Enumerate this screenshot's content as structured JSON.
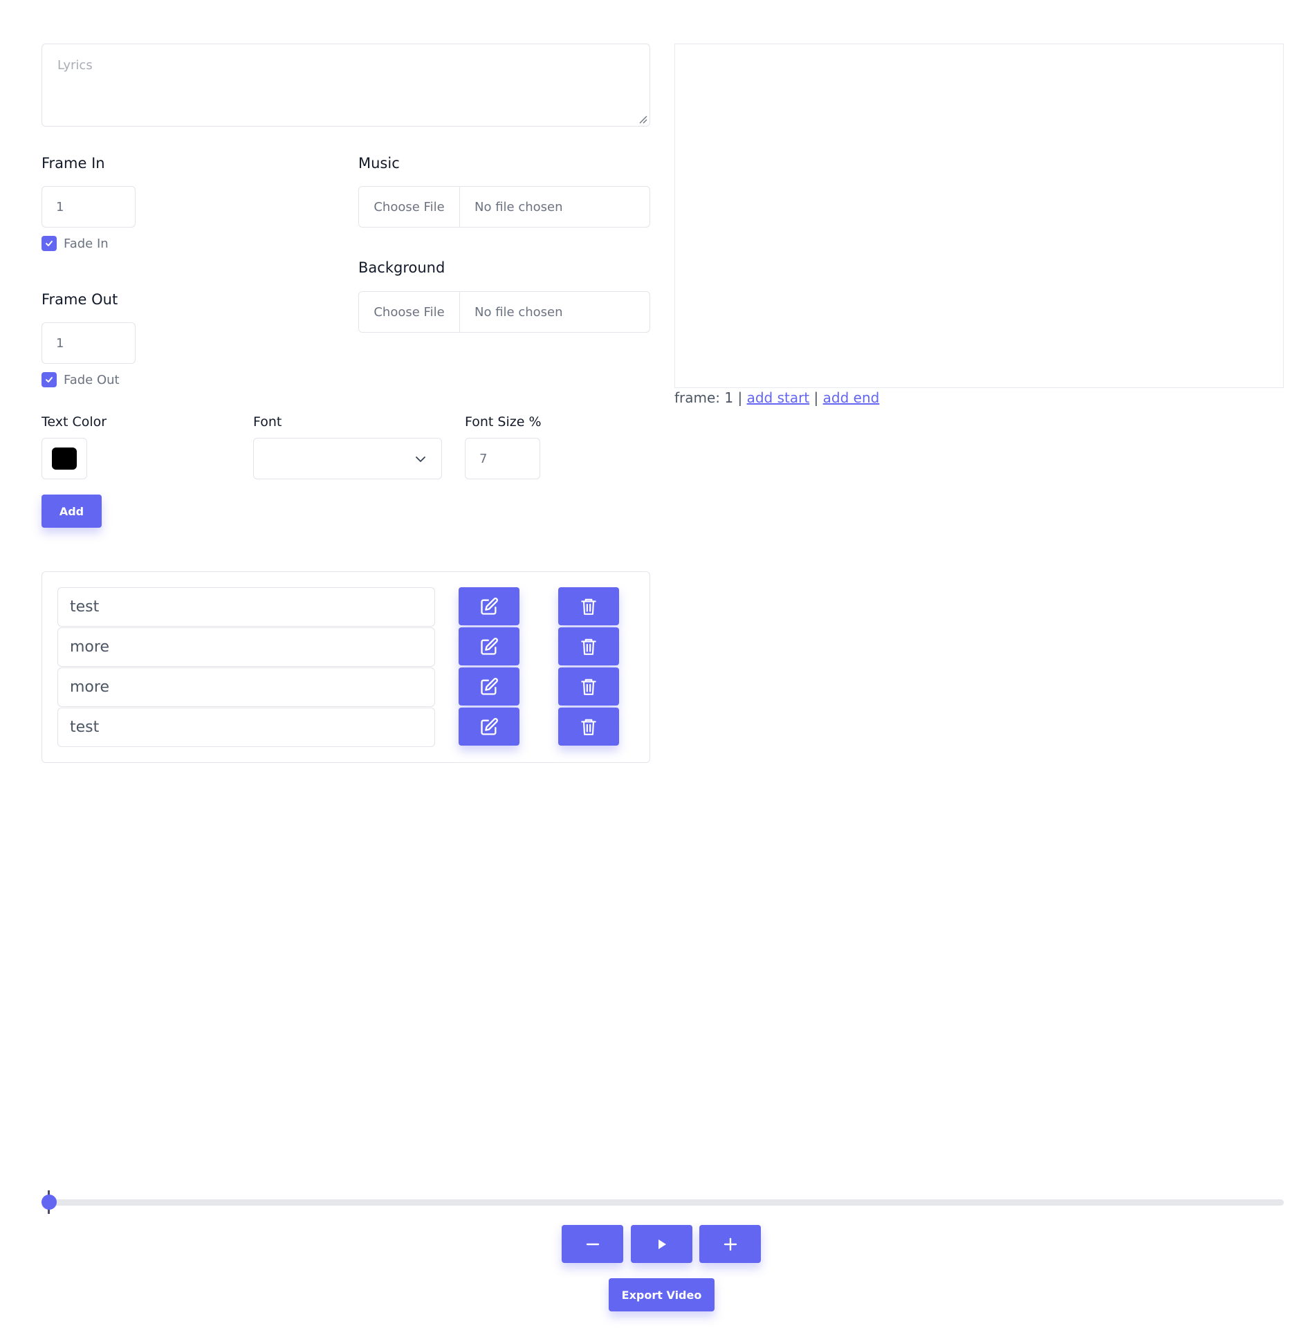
{
  "lyrics": {
    "placeholder": "Lyrics",
    "value": ""
  },
  "frame_in": {
    "label": "Frame In",
    "value": "1",
    "fade_label": "Fade In",
    "fade_checked": true
  },
  "frame_out": {
    "label": "Frame Out",
    "value": "1",
    "fade_label": "Fade Out",
    "fade_checked": true
  },
  "music": {
    "label": "Music",
    "button": "Choose File",
    "file": "No file chosen"
  },
  "background": {
    "label": "Background",
    "button": "Choose File",
    "file": "No file chosen"
  },
  "text_color": {
    "label": "Text Color",
    "value": "#000000"
  },
  "font": {
    "label": "Font",
    "value": ""
  },
  "font_size": {
    "label": "Font Size %",
    "value": "7"
  },
  "add_button": "Add",
  "preview": {
    "frame_prefix": "frame: 1 |",
    "separator": "|",
    "add_start": "add start",
    "add_end": "add end"
  },
  "lyric_items": [
    {
      "text": "test",
      "edit_icon": "edit-icon",
      "delete_icon": "trash-icon"
    },
    {
      "text": "more",
      "edit_icon": "edit-icon",
      "delete_icon": "trash-icon"
    },
    {
      "text": "more",
      "edit_icon": "edit-icon",
      "delete_icon": "trash-icon"
    },
    {
      "text": "test",
      "edit_icon": "edit-icon",
      "delete_icon": "trash-icon"
    }
  ],
  "timeline": {
    "position": 0
  },
  "controls": {
    "minus_icon": "minus-icon",
    "play_icon": "play-icon",
    "plus_icon": "plus-icon"
  },
  "export_button": "Export Video",
  "colors": {
    "accent": "#6366f1",
    "border": "#e2e4ea",
    "track": "#e5e7eb"
  }
}
